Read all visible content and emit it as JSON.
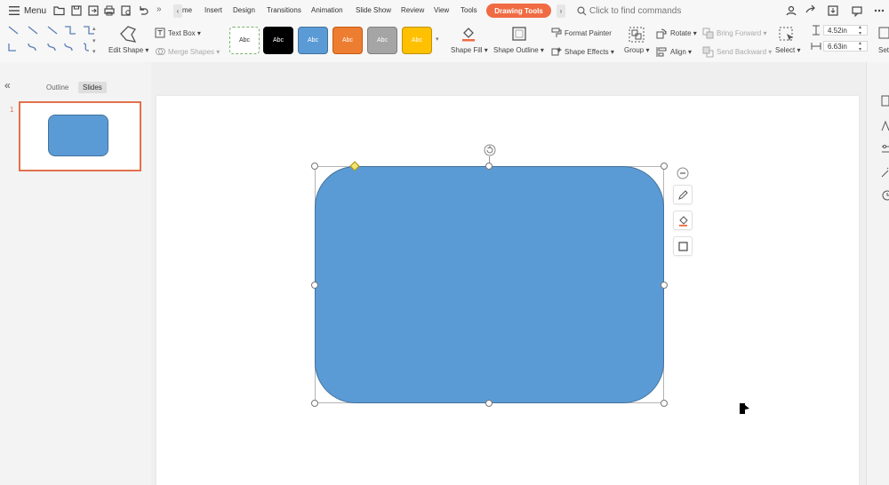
{
  "menubar": {
    "menu_label": "Menu",
    "tabs": [
      {
        "label": "me"
      },
      {
        "label": "Insert"
      },
      {
        "label": "Design"
      },
      {
        "label": "Transitions"
      },
      {
        "label": "Animation"
      },
      {
        "label": "Slide Show"
      },
      {
        "label": "Review"
      },
      {
        "label": "View"
      },
      {
        "label": "Tools"
      }
    ],
    "active_tab": "Drawing Tools",
    "overflow_glyph": "»",
    "prev_glyph": "‹",
    "next_glyph": "›",
    "search_placeholder": "Click to find commands"
  },
  "ribbon": {
    "edit_shape": "Edit Shape",
    "text_box": "Text Box",
    "merge_shapes": "Merge Shapes",
    "styles": [
      {
        "label": "Abc",
        "bg": "#ffffff",
        "fg": "#333333",
        "border": "#7bb36b"
      },
      {
        "label": "Abc",
        "bg": "#000000",
        "fg": "#ffffff",
        "border": "#000000"
      },
      {
        "label": "Abc",
        "bg": "#5b9bd5",
        "fg": "#ffffff",
        "border": "#41719c"
      },
      {
        "label": "Abc",
        "bg": "#ed7d31",
        "fg": "#ffffff",
        "border": "#c55a11"
      },
      {
        "label": "Abc",
        "bg": "#a5a5a5",
        "fg": "#ffffff",
        "border": "#7f7f7f"
      },
      {
        "label": "Abc",
        "bg": "#ffc000",
        "fg": "#ffffff",
        "border": "#bf9000"
      }
    ],
    "shape_fill": "Shape Fill",
    "shape_outline": "Shape Outline",
    "format_painter": "Format Painter",
    "shape_effects": "Shape Effects",
    "group": "Group",
    "rotate": "Rotate",
    "align": "Align",
    "bring_forward": "Bring Forward",
    "send_backward": "Send Backward",
    "select": "Select",
    "height_value": "4.52in",
    "width_value": "6.63in",
    "cut_label": "Set"
  },
  "left_panel": {
    "tab_outline": "Outline",
    "tab_slides": "Slides",
    "collapse_glyph": "«",
    "slide_number": "1"
  },
  "colors": {
    "accent": "#f06b43",
    "shape_fill": "#5b9bd5",
    "shape_outline": "#41719c",
    "handle_adjust": "#f5e36a"
  }
}
